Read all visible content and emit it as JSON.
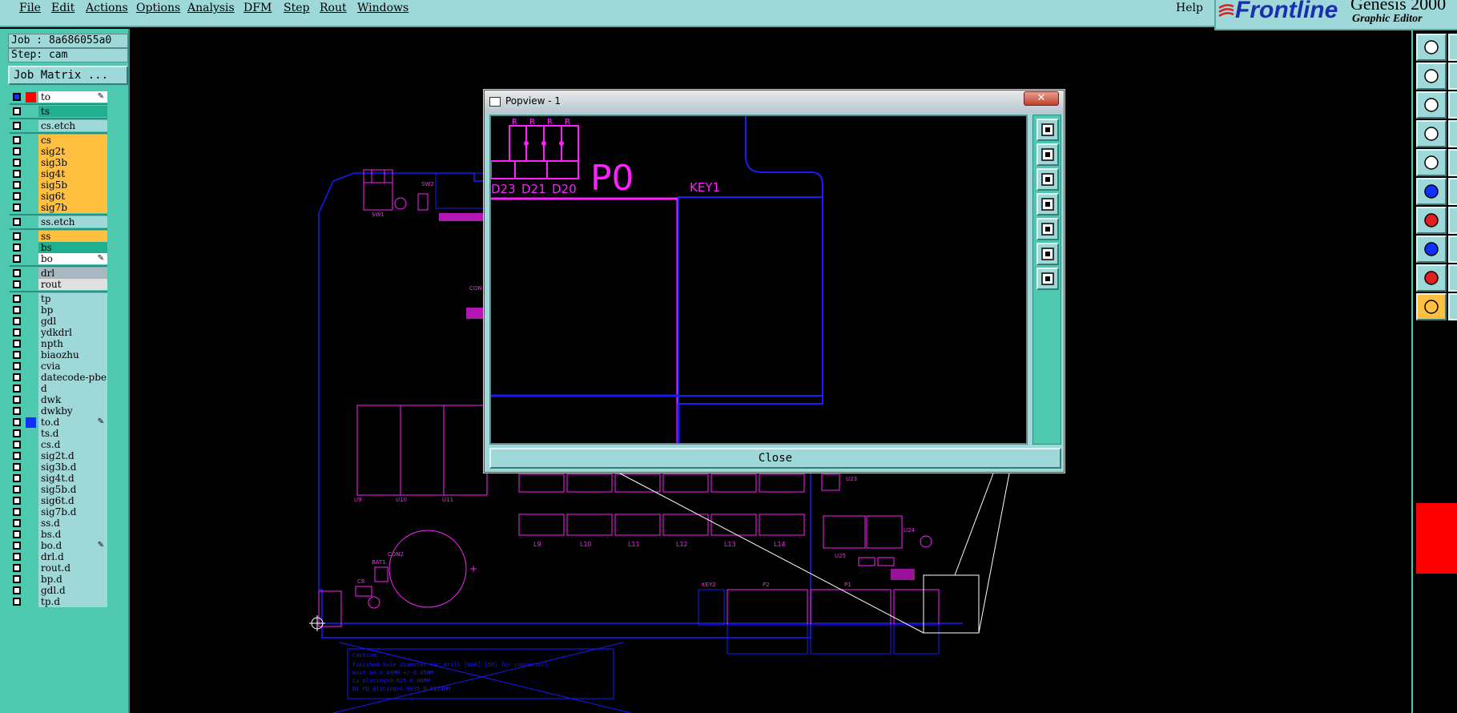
{
  "menu": {
    "items": [
      {
        "label": "File"
      },
      {
        "label": "Edit"
      },
      {
        "label": "Actions"
      },
      {
        "label": "Options"
      },
      {
        "label": "Analysis"
      },
      {
        "label": "DFM"
      },
      {
        "label": "Step"
      },
      {
        "label": "Rout"
      },
      {
        "label": "Windows"
      }
    ],
    "help": "Help"
  },
  "brand": {
    "name": "Frontline",
    "product": "Genesis 2000",
    "subtitle": "Graphic Editor"
  },
  "job": {
    "job_text": "Job : 8a686055a0",
    "step_text": "Step: cam",
    "matrix_button": "Job Matrix ..."
  },
  "layers": [
    {
      "name": "to",
      "bg": "#ffffff",
      "swatch": "#ff0000",
      "flag": "✎",
      "cb_on": true
    },
    {
      "name": "ts",
      "bg": "#20b090",
      "swatch": "",
      "flag": "",
      "cb_on": false
    },
    {
      "name": "cs.etch",
      "bg": "#9fd8d8",
      "swatch": "",
      "flag": "",
      "cb_on": false
    },
    {
      "name": "cs",
      "bg": "#ffc040",
      "swatch": "",
      "flag": "",
      "cb_on": false
    },
    {
      "name": "sig2t",
      "bg": "#ffc040",
      "swatch": "",
      "flag": "",
      "cb_on": false
    },
    {
      "name": "sig3b",
      "bg": "#ffc040",
      "swatch": "",
      "flag": "",
      "cb_on": false
    },
    {
      "name": "sig4t",
      "bg": "#ffc040",
      "swatch": "",
      "flag": "",
      "cb_on": false
    },
    {
      "name": "sig5b",
      "bg": "#ffc040",
      "swatch": "",
      "flag": "",
      "cb_on": false
    },
    {
      "name": "sig6t",
      "bg": "#ffc040",
      "swatch": "",
      "flag": "",
      "cb_on": false
    },
    {
      "name": "sig7b",
      "bg": "#ffc040",
      "swatch": "",
      "flag": "",
      "cb_on": false
    },
    {
      "name": "ss.etch",
      "bg": "#9fd8d8",
      "swatch": "",
      "flag": "",
      "cb_on": false
    },
    {
      "name": "ss",
      "bg": "#ffc040",
      "swatch": "",
      "flag": "",
      "cb_on": false
    },
    {
      "name": "bs",
      "bg": "#20b090",
      "swatch": "",
      "flag": "",
      "cb_on": false
    },
    {
      "name": "bo",
      "bg": "#ffffff",
      "swatch": "",
      "flag": "✎",
      "cb_on": false
    },
    {
      "name": "drl",
      "bg": "#a8b8c0",
      "swatch": "",
      "flag": "",
      "cb_on": false
    },
    {
      "name": "rout",
      "bg": "#e0e0e0",
      "swatch": "",
      "flag": "",
      "cb_on": false
    },
    {
      "name": "tp",
      "bg": "#9fd8d8",
      "swatch": "",
      "flag": "",
      "cb_on": false
    },
    {
      "name": "bp",
      "bg": "#9fd8d8",
      "swatch": "",
      "flag": "",
      "cb_on": false
    },
    {
      "name": "gdl",
      "bg": "#9fd8d8",
      "swatch": "",
      "flag": "",
      "cb_on": false
    },
    {
      "name": "ydkdrl",
      "bg": "#9fd8d8",
      "swatch": "",
      "flag": "",
      "cb_on": false
    },
    {
      "name": "npth",
      "bg": "#9fd8d8",
      "swatch": "",
      "flag": "",
      "cb_on": false
    },
    {
      "name": "biaozhu",
      "bg": "#9fd8d8",
      "swatch": "",
      "flag": "",
      "cb_on": false
    },
    {
      "name": "cvia",
      "bg": "#9fd8d8",
      "swatch": "",
      "flag": "",
      "cb_on": false
    },
    {
      "name": "datecode-pbe",
      "bg": "#9fd8d8",
      "swatch": "",
      "flag": "",
      "cb_on": false
    },
    {
      "name": "d",
      "bg": "#9fd8d8",
      "swatch": "",
      "flag": "",
      "cb_on": false
    },
    {
      "name": "dwk",
      "bg": "#9fd8d8",
      "swatch": "",
      "flag": "",
      "cb_on": false
    },
    {
      "name": "dwkby",
      "bg": "#9fd8d8",
      "swatch": "",
      "flag": "",
      "cb_on": false
    },
    {
      "name": "to.d",
      "bg": "#9fd8d8",
      "swatch": "#1030ff",
      "flag": "✎",
      "cb_on": false
    },
    {
      "name": "ts.d",
      "bg": "#9fd8d8",
      "swatch": "",
      "flag": "",
      "cb_on": false
    },
    {
      "name": "cs.d",
      "bg": "#9fd8d8",
      "swatch": "",
      "flag": "",
      "cb_on": false
    },
    {
      "name": "sig2t.d",
      "bg": "#9fd8d8",
      "swatch": "",
      "flag": "",
      "cb_on": false
    },
    {
      "name": "sig3b.d",
      "bg": "#9fd8d8",
      "swatch": "",
      "flag": "",
      "cb_on": false
    },
    {
      "name": "sig4t.d",
      "bg": "#9fd8d8",
      "swatch": "",
      "flag": "",
      "cb_on": false
    },
    {
      "name": "sig5b.d",
      "bg": "#9fd8d8",
      "swatch": "",
      "flag": "",
      "cb_on": false
    },
    {
      "name": "sig6t.d",
      "bg": "#9fd8d8",
      "swatch": "",
      "flag": "",
      "cb_on": false
    },
    {
      "name": "sig7b.d",
      "bg": "#9fd8d8",
      "swatch": "",
      "flag": "",
      "cb_on": false
    },
    {
      "name": "ss.d",
      "bg": "#9fd8d8",
      "swatch": "",
      "flag": "",
      "cb_on": false
    },
    {
      "name": "bs.d",
      "bg": "#9fd8d8",
      "swatch": "",
      "flag": "",
      "cb_on": false
    },
    {
      "name": "bo.d",
      "bg": "#9fd8d8",
      "swatch": "",
      "flag": "✎",
      "cb_on": false
    },
    {
      "name": "drl.d",
      "bg": "#9fd8d8",
      "swatch": "",
      "flag": "",
      "cb_on": false
    },
    {
      "name": "rout.d",
      "bg": "#9fd8d8",
      "swatch": "",
      "flag": "",
      "cb_on": false
    },
    {
      "name": "bp.d",
      "bg": "#9fd8d8",
      "swatch": "",
      "flag": "",
      "cb_on": false
    },
    {
      "name": "gdl.d",
      "bg": "#9fd8d8",
      "swatch": "",
      "flag": "",
      "cb_on": false
    },
    {
      "name": "tp.d",
      "bg": "#9fd8d8",
      "swatch": "",
      "flag": "",
      "cb_on": false
    }
  ],
  "board": {
    "labels": [
      "SW1",
      "SW2",
      "CON",
      "U9",
      "U10",
      "U11",
      "BAT1",
      "CON2",
      "C8",
      "L9",
      "L10",
      "L11",
      "L12",
      "L13",
      "L14",
      "U23",
      "U24",
      "U25",
      "KEY2",
      "P2",
      "P1"
    ],
    "caution_lines": [
      "Caution:",
      "Finished hole diameter for drill [0n0] [50] for connector]",
      "must be 0.49MM +/-0.05MM",
      "Cu plating=0.025-0.08MM",
      "Ni PD plating=0.0035-0.0124MM"
    ]
  },
  "popview": {
    "title": "Popview - 1",
    "close_x": "✕",
    "close_button": "Close",
    "view_labels": {
      "refdes": "P0",
      "key": "KEY1",
      "d23": "D23",
      "d21": "D21",
      "d20": "D20",
      "r": "R"
    },
    "tools": [
      "zoom-fit-icon",
      "zoom-in-icon",
      "zoom-out-icon",
      "pan-left-icon",
      "pan-right-icon",
      "zoom-all-icon",
      "zoom-area-icon"
    ]
  },
  "right_tools": [
    "clipboard-icon",
    "window-icon",
    "fit-icon",
    "probe-icon",
    "snap-icon",
    "network-icon",
    "measure-icon",
    "select-color-icon",
    "triangle-icon",
    "pointer-icon"
  ],
  "colors": {
    "panel": "#9fd8d8",
    "panel_dark": "#4fc8b0",
    "board_outline": "#1a1aff",
    "component": "#ff20ff",
    "selection": "#ffffff"
  }
}
